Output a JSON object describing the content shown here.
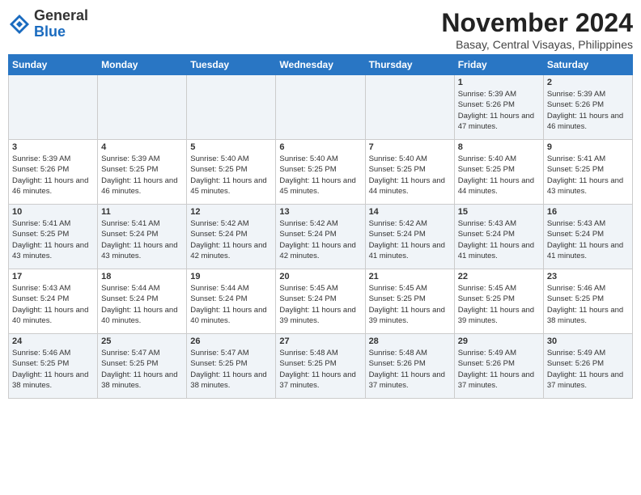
{
  "header": {
    "logo": {
      "general": "General",
      "blue": "Blue"
    },
    "title": "November 2024",
    "subtitle": "Basay, Central Visayas, Philippines"
  },
  "days_of_week": [
    "Sunday",
    "Monday",
    "Tuesday",
    "Wednesday",
    "Thursday",
    "Friday",
    "Saturday"
  ],
  "weeks": [
    [
      {
        "day": "",
        "info": ""
      },
      {
        "day": "",
        "info": ""
      },
      {
        "day": "",
        "info": ""
      },
      {
        "day": "",
        "info": ""
      },
      {
        "day": "",
        "info": ""
      },
      {
        "day": "1",
        "info": "Sunrise: 5:39 AM\nSunset: 5:26 PM\nDaylight: 11 hours and 47 minutes."
      },
      {
        "day": "2",
        "info": "Sunrise: 5:39 AM\nSunset: 5:26 PM\nDaylight: 11 hours and 46 minutes."
      }
    ],
    [
      {
        "day": "3",
        "info": "Sunrise: 5:39 AM\nSunset: 5:26 PM\nDaylight: 11 hours and 46 minutes."
      },
      {
        "day": "4",
        "info": "Sunrise: 5:39 AM\nSunset: 5:25 PM\nDaylight: 11 hours and 46 minutes."
      },
      {
        "day": "5",
        "info": "Sunrise: 5:40 AM\nSunset: 5:25 PM\nDaylight: 11 hours and 45 minutes."
      },
      {
        "day": "6",
        "info": "Sunrise: 5:40 AM\nSunset: 5:25 PM\nDaylight: 11 hours and 45 minutes."
      },
      {
        "day": "7",
        "info": "Sunrise: 5:40 AM\nSunset: 5:25 PM\nDaylight: 11 hours and 44 minutes."
      },
      {
        "day": "8",
        "info": "Sunrise: 5:40 AM\nSunset: 5:25 PM\nDaylight: 11 hours and 44 minutes."
      },
      {
        "day": "9",
        "info": "Sunrise: 5:41 AM\nSunset: 5:25 PM\nDaylight: 11 hours and 43 minutes."
      }
    ],
    [
      {
        "day": "10",
        "info": "Sunrise: 5:41 AM\nSunset: 5:25 PM\nDaylight: 11 hours and 43 minutes."
      },
      {
        "day": "11",
        "info": "Sunrise: 5:41 AM\nSunset: 5:24 PM\nDaylight: 11 hours and 43 minutes."
      },
      {
        "day": "12",
        "info": "Sunrise: 5:42 AM\nSunset: 5:24 PM\nDaylight: 11 hours and 42 minutes."
      },
      {
        "day": "13",
        "info": "Sunrise: 5:42 AM\nSunset: 5:24 PM\nDaylight: 11 hours and 42 minutes."
      },
      {
        "day": "14",
        "info": "Sunrise: 5:42 AM\nSunset: 5:24 PM\nDaylight: 11 hours and 41 minutes."
      },
      {
        "day": "15",
        "info": "Sunrise: 5:43 AM\nSunset: 5:24 PM\nDaylight: 11 hours and 41 minutes."
      },
      {
        "day": "16",
        "info": "Sunrise: 5:43 AM\nSunset: 5:24 PM\nDaylight: 11 hours and 41 minutes."
      }
    ],
    [
      {
        "day": "17",
        "info": "Sunrise: 5:43 AM\nSunset: 5:24 PM\nDaylight: 11 hours and 40 minutes."
      },
      {
        "day": "18",
        "info": "Sunrise: 5:44 AM\nSunset: 5:24 PM\nDaylight: 11 hours and 40 minutes."
      },
      {
        "day": "19",
        "info": "Sunrise: 5:44 AM\nSunset: 5:24 PM\nDaylight: 11 hours and 40 minutes."
      },
      {
        "day": "20",
        "info": "Sunrise: 5:45 AM\nSunset: 5:24 PM\nDaylight: 11 hours and 39 minutes."
      },
      {
        "day": "21",
        "info": "Sunrise: 5:45 AM\nSunset: 5:25 PM\nDaylight: 11 hours and 39 minutes."
      },
      {
        "day": "22",
        "info": "Sunrise: 5:45 AM\nSunset: 5:25 PM\nDaylight: 11 hours and 39 minutes."
      },
      {
        "day": "23",
        "info": "Sunrise: 5:46 AM\nSunset: 5:25 PM\nDaylight: 11 hours and 38 minutes."
      }
    ],
    [
      {
        "day": "24",
        "info": "Sunrise: 5:46 AM\nSunset: 5:25 PM\nDaylight: 11 hours and 38 minutes."
      },
      {
        "day": "25",
        "info": "Sunrise: 5:47 AM\nSunset: 5:25 PM\nDaylight: 11 hours and 38 minutes."
      },
      {
        "day": "26",
        "info": "Sunrise: 5:47 AM\nSunset: 5:25 PM\nDaylight: 11 hours and 38 minutes."
      },
      {
        "day": "27",
        "info": "Sunrise: 5:48 AM\nSunset: 5:25 PM\nDaylight: 11 hours and 37 minutes."
      },
      {
        "day": "28",
        "info": "Sunrise: 5:48 AM\nSunset: 5:26 PM\nDaylight: 11 hours and 37 minutes."
      },
      {
        "day": "29",
        "info": "Sunrise: 5:49 AM\nSunset: 5:26 PM\nDaylight: 11 hours and 37 minutes."
      },
      {
        "day": "30",
        "info": "Sunrise: 5:49 AM\nSunset: 5:26 PM\nDaylight: 11 hours and 37 minutes."
      }
    ]
  ]
}
